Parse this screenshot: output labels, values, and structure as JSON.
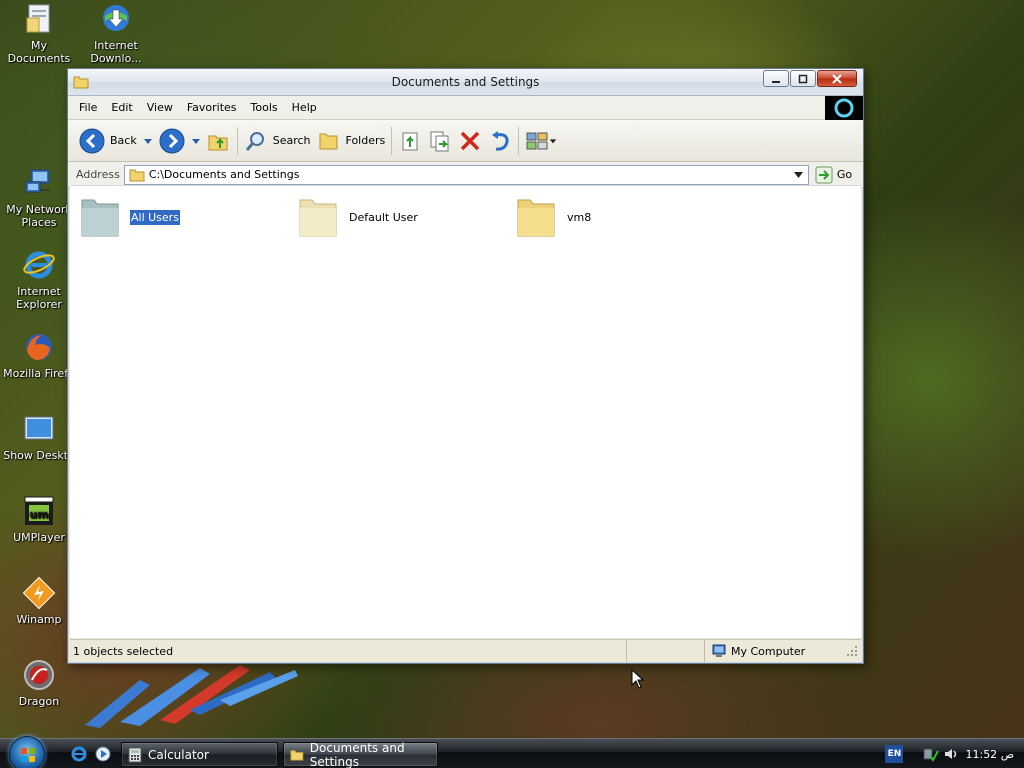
{
  "desktop": {
    "icons": [
      {
        "label": "My Documents"
      },
      {
        "label": "Internet Downlo..."
      },
      {
        "label": "My Network Places"
      },
      {
        "label": "Internet Explorer"
      },
      {
        "label": "Mozilla Firefo"
      },
      {
        "label": "Show Deskto"
      },
      {
        "label": "UMPlayer"
      },
      {
        "label": "Winamp"
      },
      {
        "label": "Dragon"
      }
    ]
  },
  "window": {
    "title": "Documents and Settings",
    "menu": [
      "File",
      "Edit",
      "View",
      "Favorites",
      "Tools",
      "Help"
    ],
    "toolbar": {
      "back_label": "Back",
      "search_label": "Search",
      "folders_label": "Folders"
    },
    "address": {
      "label": "Address",
      "value": "C:\\Documents and Settings",
      "go_label": "Go"
    },
    "folders": [
      {
        "name": "All Users",
        "selected": true
      },
      {
        "name": "Default User",
        "selected": false
      },
      {
        "name": "vm8",
        "selected": false
      }
    ],
    "status": {
      "left": "1 objects selected",
      "zone": "My Computer"
    }
  },
  "taskbar": {
    "tasks": [
      {
        "label": "Calculator"
      },
      {
        "label": "Documents and Settings"
      }
    ],
    "language": "EN",
    "clock": "11:52 ص"
  },
  "colors": {
    "selection": "#316ac5",
    "folder": "#f2dc8a"
  }
}
